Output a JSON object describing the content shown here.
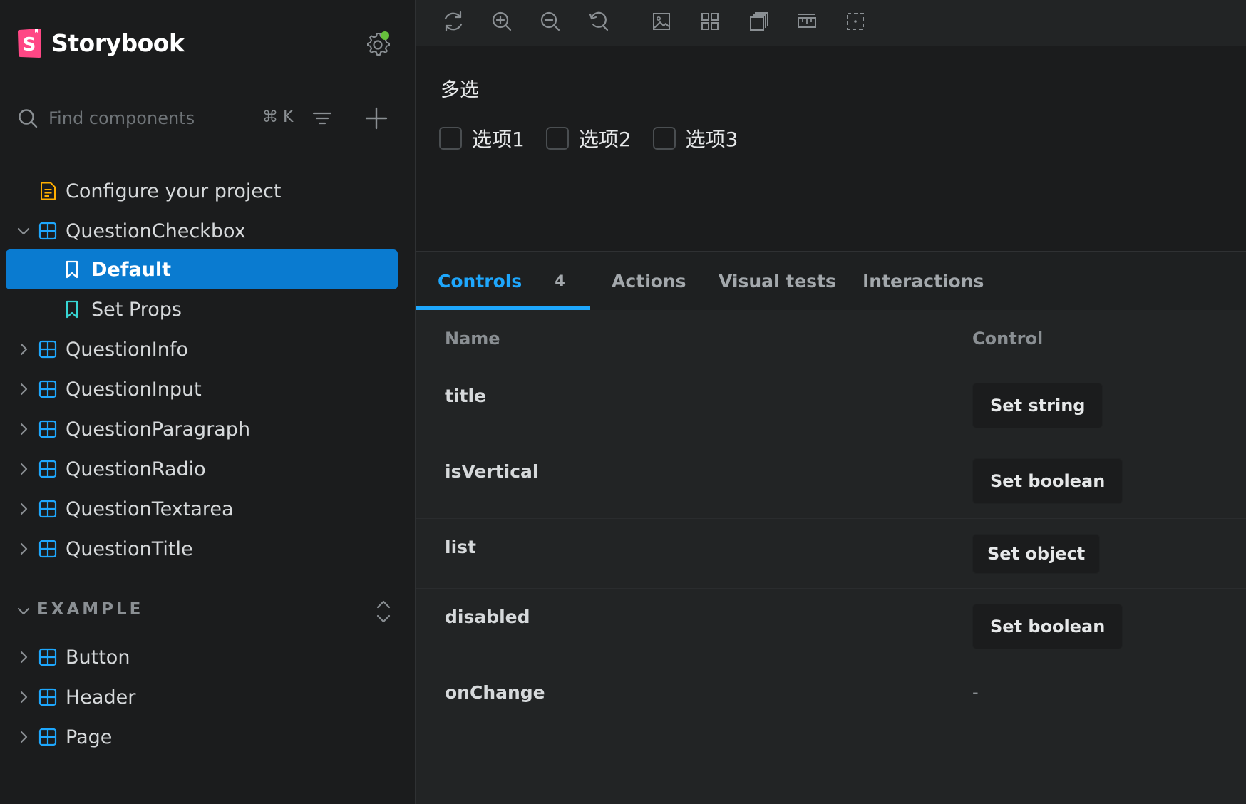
{
  "sidebar": {
    "brand": "Storybook",
    "search": {
      "placeholder": "Find components",
      "shortcut": "⌘ K"
    },
    "items": [
      {
        "label": "Configure your project",
        "type": "doc"
      },
      {
        "label": "QuestionCheckbox",
        "type": "component",
        "expanded": true
      },
      {
        "label": "Default",
        "type": "story",
        "selected": true
      },
      {
        "label": "Set Props",
        "type": "story"
      },
      {
        "label": "QuestionInfo",
        "type": "component"
      },
      {
        "label": "QuestionInput",
        "type": "component"
      },
      {
        "label": "QuestionParagraph",
        "type": "component"
      },
      {
        "label": "QuestionRadio",
        "type": "component"
      },
      {
        "label": "QuestionTextarea",
        "type": "component"
      },
      {
        "label": "QuestionTitle",
        "type": "component"
      }
    ],
    "section": {
      "label": "EXAMPLE",
      "items": [
        {
          "label": "Button",
          "type": "component"
        },
        {
          "label": "Header",
          "type": "component"
        },
        {
          "label": "Page",
          "type": "component"
        }
      ]
    }
  },
  "toolbar": {
    "icons": [
      "reload-icon",
      "zoom-in-icon",
      "zoom-out-icon",
      "zoom-reset-icon",
      "background-icon",
      "grid-icon",
      "viewport-icon",
      "measure-icon",
      "outline-icon"
    ]
  },
  "canvas": {
    "title": "多选",
    "options": [
      "选项1",
      "选项2",
      "选项3"
    ]
  },
  "panel": {
    "tabs": [
      {
        "label": "Controls",
        "count": "4"
      },
      {
        "label": "Actions"
      },
      {
        "label": "Visual tests"
      },
      {
        "label": "Interactions"
      }
    ],
    "headers": {
      "name": "Name",
      "control": "Control"
    },
    "rows": [
      {
        "name": "title",
        "control": "Set string"
      },
      {
        "name": "isVertical",
        "control": "Set boolean"
      },
      {
        "name": "list",
        "control": "Set object"
      },
      {
        "name": "disabled",
        "control": "Set boolean"
      },
      {
        "name": "onChange",
        "control": "-"
      }
    ]
  },
  "colors": {
    "accent": "#1ea7fd",
    "selected": "#0a7bd0",
    "brand": "#ff4785",
    "component_icon": "#1ea7fd",
    "story_icon": "#37d5d3",
    "doc_icon": "#ffae00",
    "status_dot": "#66bf3c"
  }
}
